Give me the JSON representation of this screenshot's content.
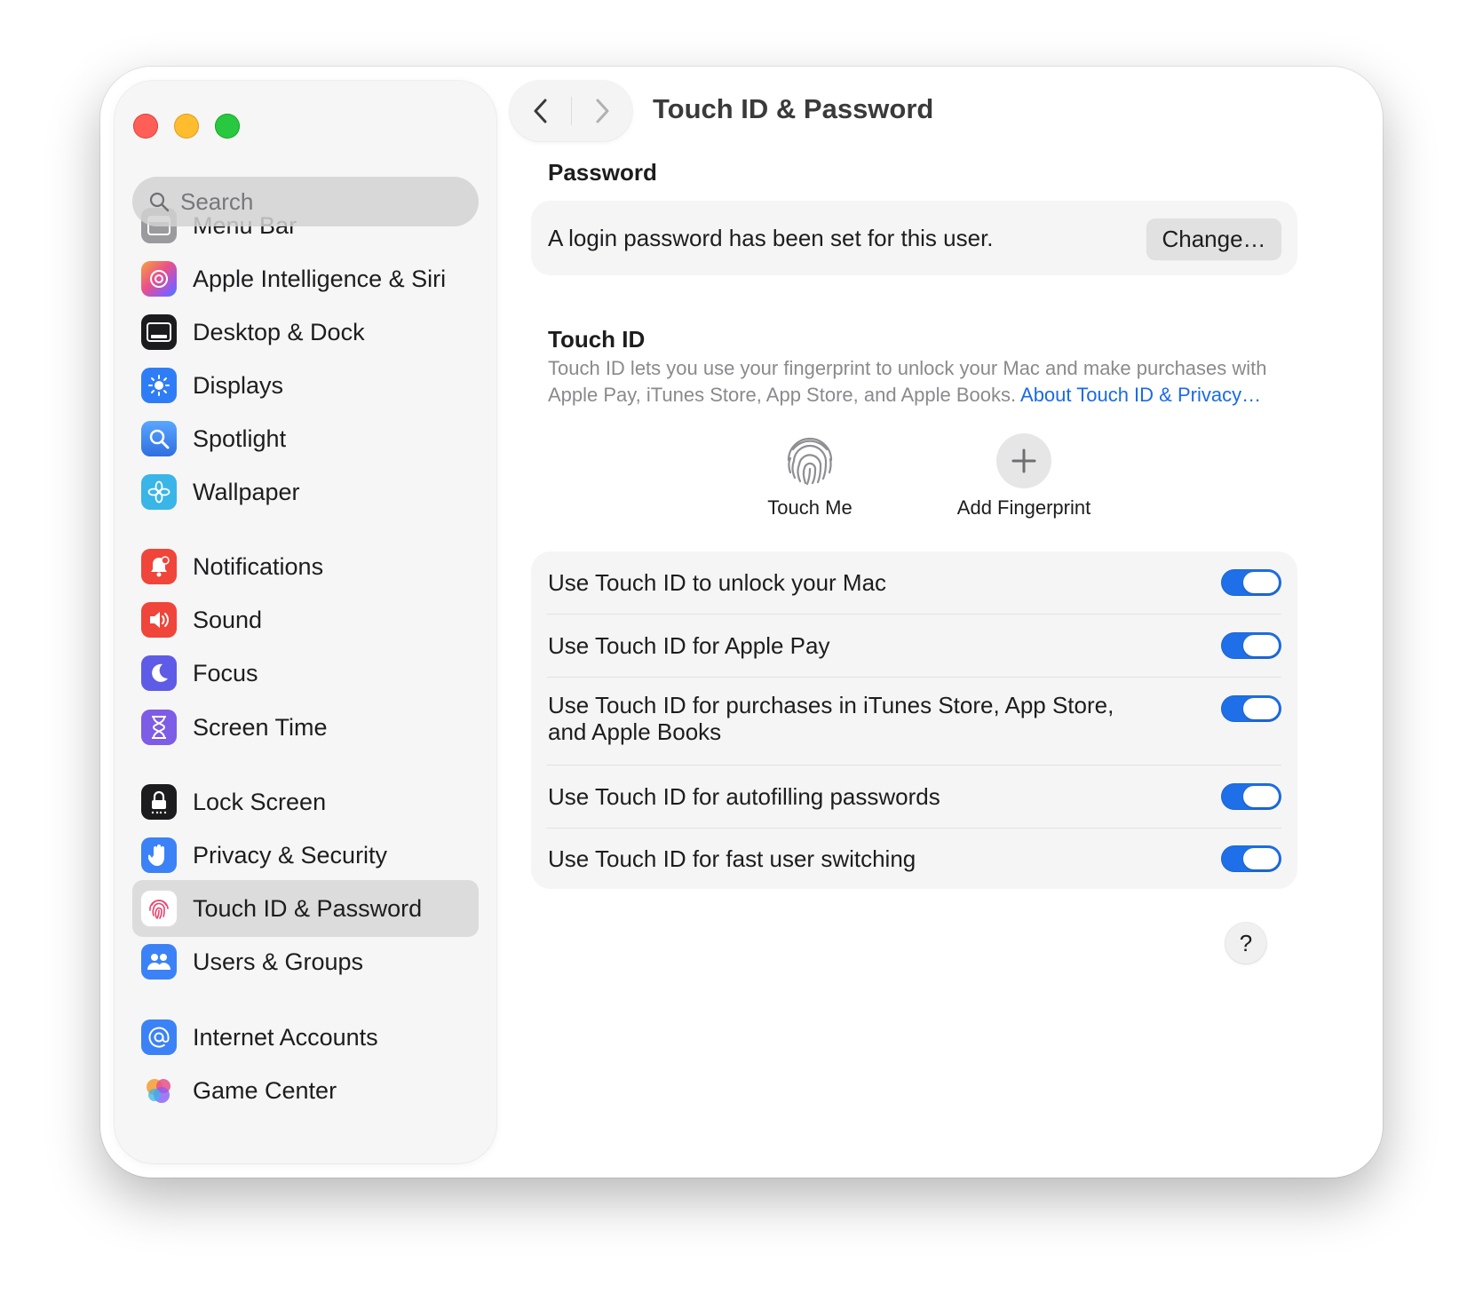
{
  "window": {
    "title": "Touch ID & Password"
  },
  "search": {
    "placeholder": "Search"
  },
  "sidebar": {
    "items": [
      {
        "label": "Menu Bar",
        "icon": "menu-bar-icon",
        "color": "#8e8e93"
      },
      {
        "label": "Apple Intelligence & Siri",
        "icon": "siri-icon",
        "color": "#e8508a"
      },
      {
        "label": "Desktop & Dock",
        "icon": "dock-icon",
        "color": "#1c1c1e"
      },
      {
        "label": "Displays",
        "icon": "sun-icon",
        "color": "#2f7df6"
      },
      {
        "label": "Spotlight",
        "icon": "magnifier-icon",
        "color": "#3b82f6"
      },
      {
        "label": "Wallpaper",
        "icon": "flower-icon",
        "color": "#39b5e8"
      },
      {
        "label": "Notifications",
        "icon": "bell-icon",
        "color": "#f0453a"
      },
      {
        "label": "Sound",
        "icon": "speaker-icon",
        "color": "#f0453a"
      },
      {
        "label": "Focus",
        "icon": "moon-icon",
        "color": "#5e5ce6"
      },
      {
        "label": "Screen Time",
        "icon": "hourglass-icon",
        "color": "#7d5ce6"
      },
      {
        "label": "Lock Screen",
        "icon": "lock-icon",
        "color": "#1c1c1e"
      },
      {
        "label": "Privacy & Security",
        "icon": "hand-icon",
        "color": "#3b82f6"
      },
      {
        "label": "Touch ID & Password",
        "icon": "fingerprint-icon",
        "color": "#ffffff"
      },
      {
        "label": "Users & Groups",
        "icon": "users-icon",
        "color": "#3b82f6"
      },
      {
        "label": "Internet Accounts",
        "icon": "at-icon",
        "color": "#3b82f6"
      },
      {
        "label": "Game Center",
        "icon": "game-center-icon",
        "color": "#f5f5f5"
      }
    ],
    "selected": "Touch ID & Password"
  },
  "password": {
    "heading": "Password",
    "status": "A login password has been set for this user.",
    "change_label": "Change…"
  },
  "touchid": {
    "heading": "Touch ID",
    "description": "Touch ID lets you use your fingerprint to unlock your Mac and make purchases with Apple Pay, iTunes Store, App Store, and Apple Books.",
    "link": "About Touch ID & Privacy…",
    "fingerprint_label": "Touch Me",
    "add_label": "Add Fingerprint",
    "toggles": [
      {
        "label": "Use Touch ID to unlock your Mac",
        "on": true
      },
      {
        "label": "Use Touch ID for Apple Pay",
        "on": true
      },
      {
        "label": "Use Touch ID for purchases in iTunes Store, App Store, and Apple Books",
        "on": true
      },
      {
        "label": "Use Touch ID for autofilling passwords",
        "on": true
      },
      {
        "label": "Use Touch ID for fast user switching",
        "on": true
      }
    ]
  },
  "help": {
    "label": "?"
  },
  "colors": {
    "accent": "#1e6fe8",
    "link": "#1a6ae6"
  }
}
